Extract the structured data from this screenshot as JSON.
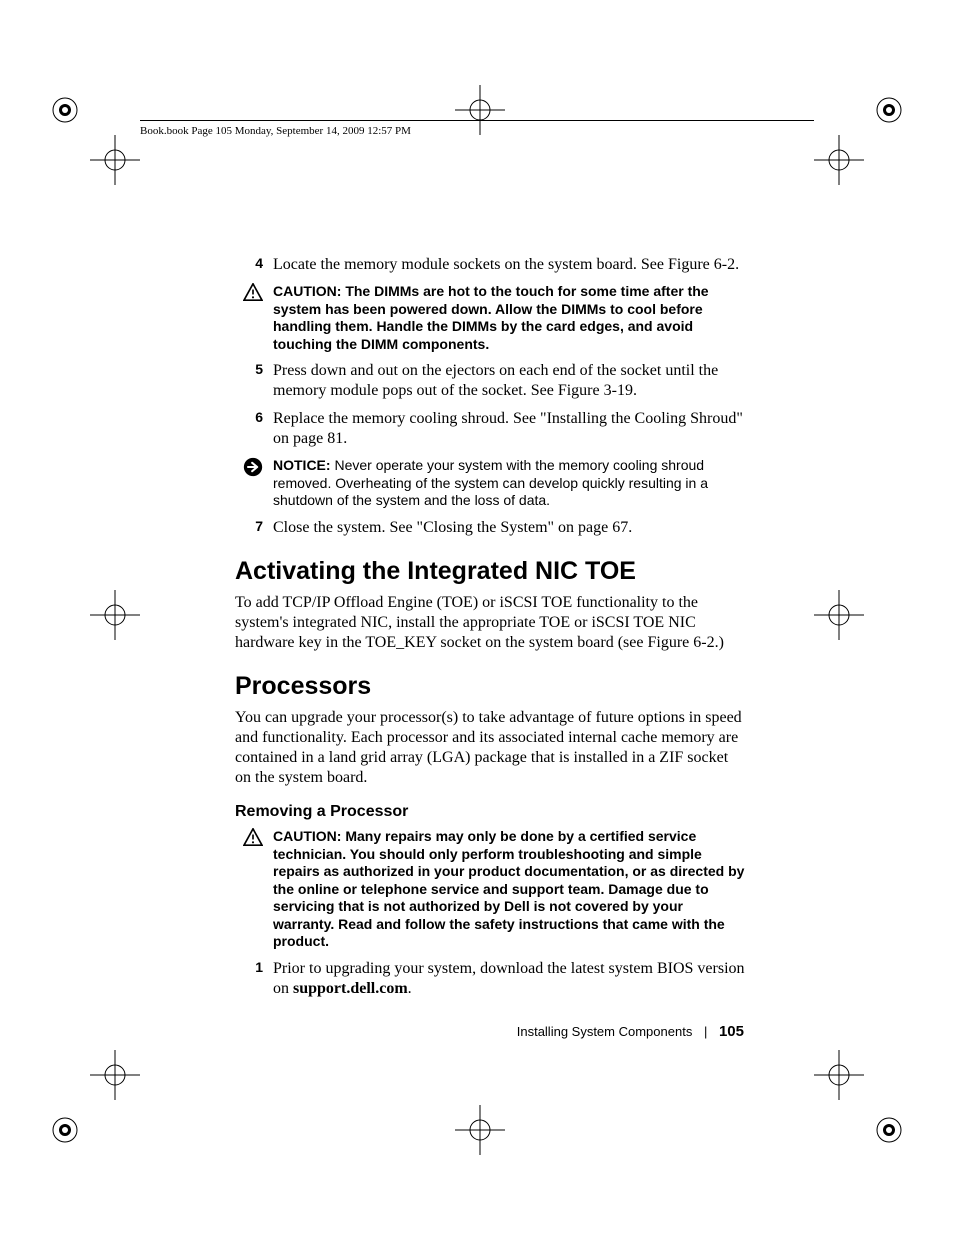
{
  "header": {
    "running_head": "Book.book  Page 105  Monday, September 14, 2009  12:57 PM"
  },
  "steps_a": [
    {
      "num": "4",
      "text": "Locate the memory module sockets on the system board. See Figure 6-2."
    }
  ],
  "caution1": {
    "label": "CAUTION:",
    "text": "The DIMMs are hot to the touch for some time after the system has been powered down. Allow the DIMMs to cool before handling them. Handle the DIMMs by the card edges, and avoid touching the DIMM components."
  },
  "steps_b": [
    {
      "num": "5",
      "text": "Press down and out on the ejectors on each end of the socket until the memory module pops out of the socket. See Figure 3-19."
    },
    {
      "num": "6",
      "text": "Replace the memory cooling shroud. See \"Installing the Cooling Shroud\" on page 81."
    }
  ],
  "notice1": {
    "label": "NOTICE:",
    "text": "Never operate your system with the memory cooling shroud removed. Overheating of the system can develop quickly resulting in a shutdown of the system and the loss of data."
  },
  "steps_c": [
    {
      "num": "7",
      "text": "Close the system. See \"Closing the System\" on page 67."
    }
  ],
  "section1": {
    "title": "Activating the Integrated NIC TOE",
    "body": "To add TCP/IP Offload Engine (TOE) or iSCSI TOE functionality to the system's integrated NIC, install the appropriate TOE or iSCSI TOE NIC hardware key in the TOE_KEY socket on the system board (see Figure 6-2.)"
  },
  "section2": {
    "title": "Processors",
    "body": "You can upgrade your processor(s) to take advantage of future options in speed and functionality. Each processor and its associated internal cache memory are contained in a land grid array (LGA) package that is installed in a ZIF socket on the system board."
  },
  "subhead1": "Removing a Processor",
  "caution2": {
    "label": "CAUTION:",
    "text": "Many repairs may only be done by a certified service technician. You should only perform troubleshooting and simple repairs as authorized in your product documentation, or as directed by the online or telephone service and support team. Damage due to servicing that is not authorized by Dell is not covered by your warranty. Read and follow the safety instructions that came with the product."
  },
  "steps_d": [
    {
      "num": "1",
      "text_pre": "Prior to upgrading your system, download the latest system BIOS version on ",
      "site": "support.dell.com",
      "text_post": "."
    }
  ],
  "footer": {
    "section": "Installing System Components",
    "page": "105"
  }
}
